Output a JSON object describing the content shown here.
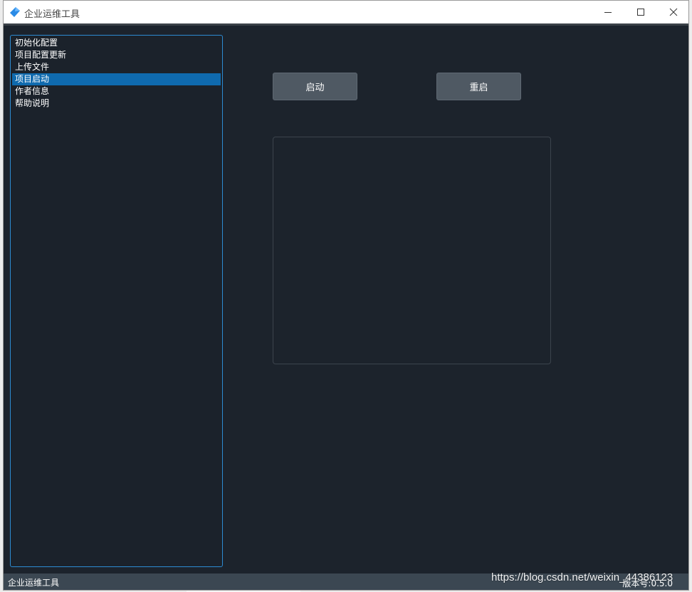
{
  "window": {
    "title": "企业运维工具"
  },
  "nav": {
    "items": [
      {
        "label": "初始化配置"
      },
      {
        "label": "项目配置更新"
      },
      {
        "label": "上传文件"
      },
      {
        "label": "项目启动",
        "selected": true
      },
      {
        "label": "作者信息"
      },
      {
        "label": "帮助说明"
      }
    ]
  },
  "actions": {
    "start_label": "启动",
    "restart_label": "重启"
  },
  "output": {
    "text": ""
  },
  "statusbar": {
    "app_name": "企业运维工具",
    "version": "版本号:0.5.0"
  },
  "watermark": {
    "text": "https://blog.csdn.net/weixin_44386123"
  },
  "colors": {
    "background": "#1c232c",
    "accent": "#2d8bd3",
    "selected": "#0f6aae",
    "button": "#4f5963",
    "statusbar": "#3b4752"
  },
  "icons": {
    "app": "blue-diamond-icon",
    "minimize": "minimize-icon",
    "maximize": "maximize-icon",
    "close": "close-icon"
  }
}
